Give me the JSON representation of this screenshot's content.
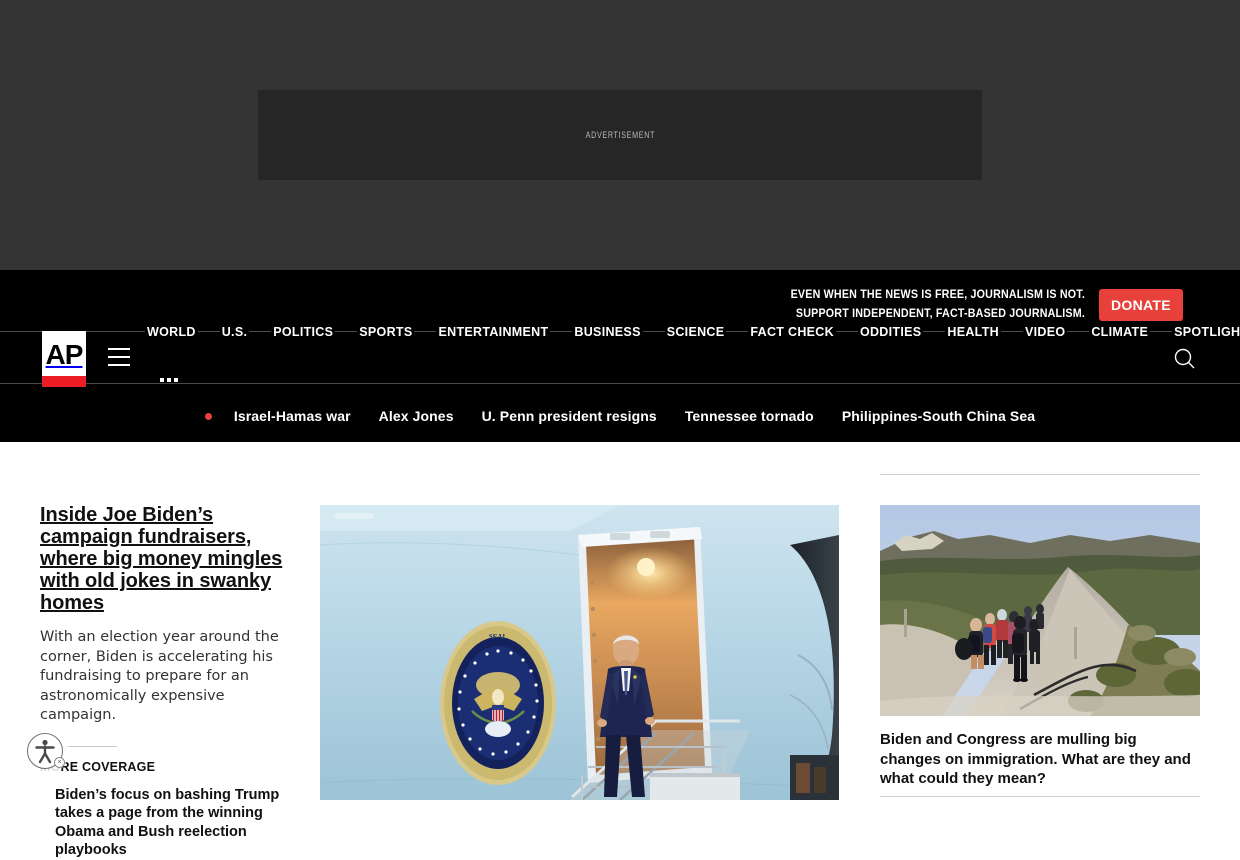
{
  "ad": {
    "label": "ADVERTISEMENT"
  },
  "header": {
    "logo_text": "AP",
    "logo_alt": "ap-logo",
    "menu_icon": "hamburger-icon",
    "search_icon": "search-icon",
    "more_icon": "ellipsis-icon",
    "promo": {
      "line1": "EVEN WHEN THE NEWS IS FREE, JOURNALISM IS NOT.",
      "line2": "SUPPORT INDEPENDENT, FACT-BASED JOURNALISM.",
      "donate_label": "DONATE",
      "donate_color": "#e8413b"
    },
    "nav": [
      {
        "label": "WORLD"
      },
      {
        "label": "U.S."
      },
      {
        "label": "POLITICS"
      },
      {
        "label": "SPORTS"
      },
      {
        "label": "ENTERTAINMENT"
      },
      {
        "label": "BUSINESS"
      },
      {
        "label": "SCIENCE"
      },
      {
        "label": "FACT CHECK"
      },
      {
        "label": "ODDITIES"
      },
      {
        "label": "HEALTH"
      },
      {
        "label": "VIDEO"
      },
      {
        "label": "CLIMATE"
      },
      {
        "label": "SPOTLIGHT"
      }
    ],
    "trending": {
      "dot_color": "#e8413b",
      "items": [
        {
          "label": "Israel-Hamas war"
        },
        {
          "label": "Alex Jones"
        },
        {
          "label": "U. Penn president resigns"
        },
        {
          "label": "Tennessee tornado"
        },
        {
          "label": "Philippines-South China Sea"
        }
      ]
    }
  },
  "main": {
    "lead": {
      "title": "Inside Joe Biden’s campaign fundraisers, where big money mingles with old jokes in swanky homes",
      "description": "With an election year around the corner, Biden is accelerating his fundraising to prepare for an astronomically expensive campaign.",
      "more_coverage_label": "MORE COVERAGE",
      "more_coverage_link": "Biden’s focus on bashing Trump takes a page from the winning Obama and Bush reelection playbooks",
      "image_alt": "President Joe Biden walks down the stairs of Air Force One bearing the Seal of the President of the United States"
    },
    "secondary": {
      "headline": "Biden and Congress are mulling big changes on immigration. What are they and what could they mean?",
      "image_alt": "Migrants walk in a line along a dirt road through brushland"
    }
  },
  "accessibility": {
    "widget_label": "accessibility-widget",
    "close_label": "×"
  }
}
